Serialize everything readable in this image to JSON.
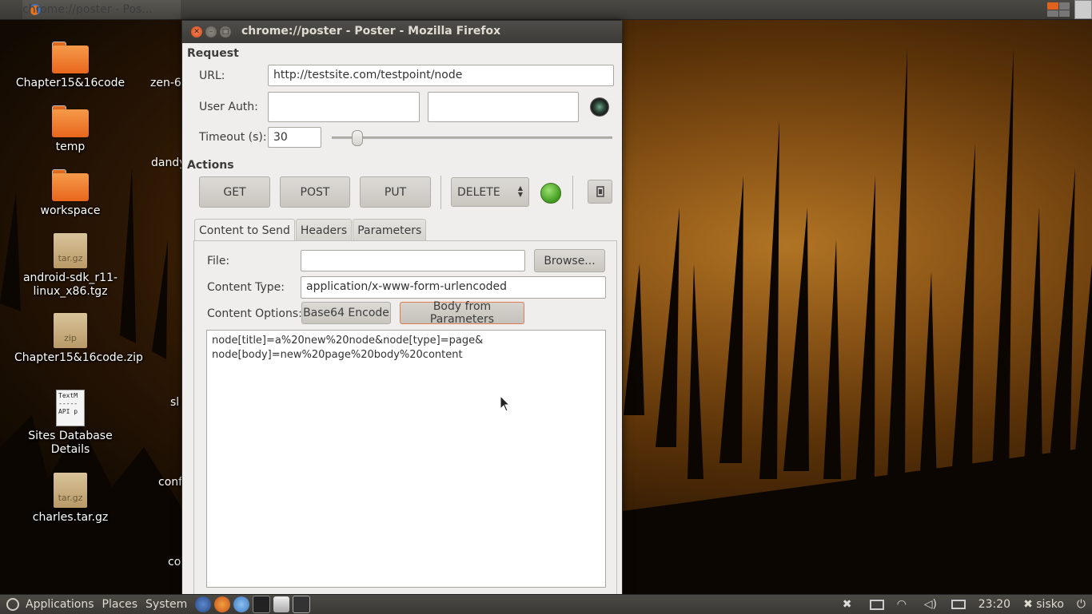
{
  "top_panel": {
    "task_title": "chrome://poster - Pos..."
  },
  "desktop": {
    "icons": [
      {
        "label": "Chapter15&16code",
        "kind": "folder"
      },
      {
        "label": "temp",
        "kind": "folder"
      },
      {
        "label": "workspace",
        "kind": "folder"
      },
      {
        "label": "android-sdk_r11-linux_x86.tgz",
        "kind": "archive",
        "badge": "tar.gz"
      },
      {
        "label": "Chapter15&16code.zip",
        "kind": "archive",
        "badge": "zip"
      },
      {
        "label": "Sites Database Details",
        "kind": "text",
        "preview": "TextM\n-----\nAPI p"
      },
      {
        "label": "charles.tar.gz",
        "kind": "archive",
        "badge": "tar.gz"
      }
    ],
    "partial_labels": [
      "zen-6.",
      "dandy",
      "sl",
      "conf",
      "co"
    ]
  },
  "window": {
    "title": "chrome://poster - Poster - Mozilla Firefox",
    "request_section": "Request",
    "url_label": "URL:",
    "url_value": "http://testsite.com/testpoint/node",
    "user_auth_label": "User Auth:",
    "user_value": "",
    "password_value": "",
    "timeout_label": "Timeout (s):",
    "timeout_value": "30",
    "timeout_slider_fraction": 0.09,
    "actions_section": "Actions",
    "buttons": {
      "get": "GET",
      "post": "POST",
      "put": "PUT"
    },
    "method_select": "DELETE",
    "tabs": [
      "Content to Send",
      "Headers",
      "Parameters"
    ],
    "active_tab": "Content to Send",
    "file_label": "File:",
    "file_value": "",
    "browse_label": "Browse...",
    "content_type_label": "Content Type:",
    "content_type_value": "application/x-www-form-urlencoded",
    "content_options_label": "Content Options:",
    "base64_label": "Base64 Encode",
    "body_from_params_label": "Body from Parameters",
    "body_line1": "node[title]=a%20new%20node&node[type]=page&",
    "body_line2": "node[body]=new%20page%20body%20content"
  },
  "bottom_panel": {
    "menus": [
      "Applications",
      "Places",
      "System"
    ],
    "clock": "23:20",
    "user": "sisko"
  },
  "colors": {
    "panel": "#3c3b37",
    "accent": "#e0621e",
    "window_bg": "#efeeec",
    "led_green": "#3f9a1e"
  }
}
